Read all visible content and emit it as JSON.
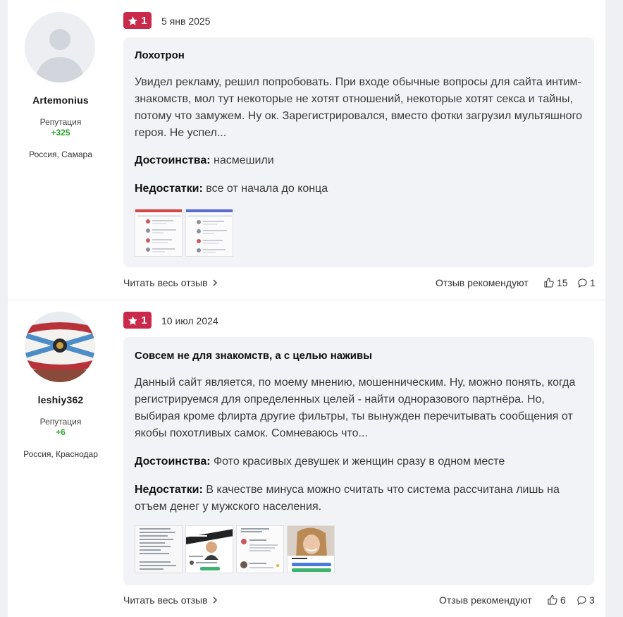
{
  "reviews": [
    {
      "user": {
        "name": "Artemonius",
        "reputation_label": "Репутация",
        "reputation": "+325",
        "location": "Россия, Самара"
      },
      "rating": "1",
      "date": "5 янв 2025",
      "title": "Лохотрон",
      "text": "Увидел рекламу, решил попробовать. При входе обычные вопросы для сайта интим-знакомств, мол тут некоторые не хотят отношений, некоторые хотят секса и тайны, потому что замужем. Ну ок. Зарегистрировался, вместо фотки загрузил мультяшного героя. Не успел...",
      "pros_label": "Достоинства:",
      "pros": "насмешили",
      "cons_label": "Недостатки:",
      "cons": "все от начала до конца",
      "read_more": "Читать весь отзыв",
      "recommend_label": "Отзыв рекомендуют",
      "likes": "15",
      "comments": "1"
    },
    {
      "user": {
        "name": "leshiy362",
        "reputation_label": "Репутация",
        "reputation": "+6",
        "location": "Россия, Краснодар"
      },
      "rating": "1",
      "date": "10 июл 2024",
      "title": "Совсем не для знакомств, а с целью наживы",
      "text": "Данный сайт является, по моему мнению, мошенническим. Ну, можно понять, когда регистрируемся для определенных целей - найти одноразового партнёра. Но, выбирая кроме флирта другие фильтры, ты вынужден перечитывать сообщения от якобы похотливых самок. Сомневаюсь что...",
      "pros_label": "Достоинства:",
      "pros": "Фото красивых девушек и женщин сразу в одном месте",
      "cons_label": "Недостатки:",
      "cons": "В качестве минуса можно считать что система рассчитана лишь на отъем денег у мужского населения.",
      "read_more": "Читать весь отзыв",
      "recommend_label": "Отзыв рекомендуют",
      "likes": "6",
      "comments": "3"
    }
  ],
  "colors": {
    "rating_badge": "#c92a4b",
    "reputation": "#2ea42e",
    "card_bg": "#f2f3f6"
  },
  "icons": [
    "star-icon",
    "chevron-right-icon",
    "thumbs-up-icon",
    "comment-icon",
    "default-avatar-icon"
  ]
}
